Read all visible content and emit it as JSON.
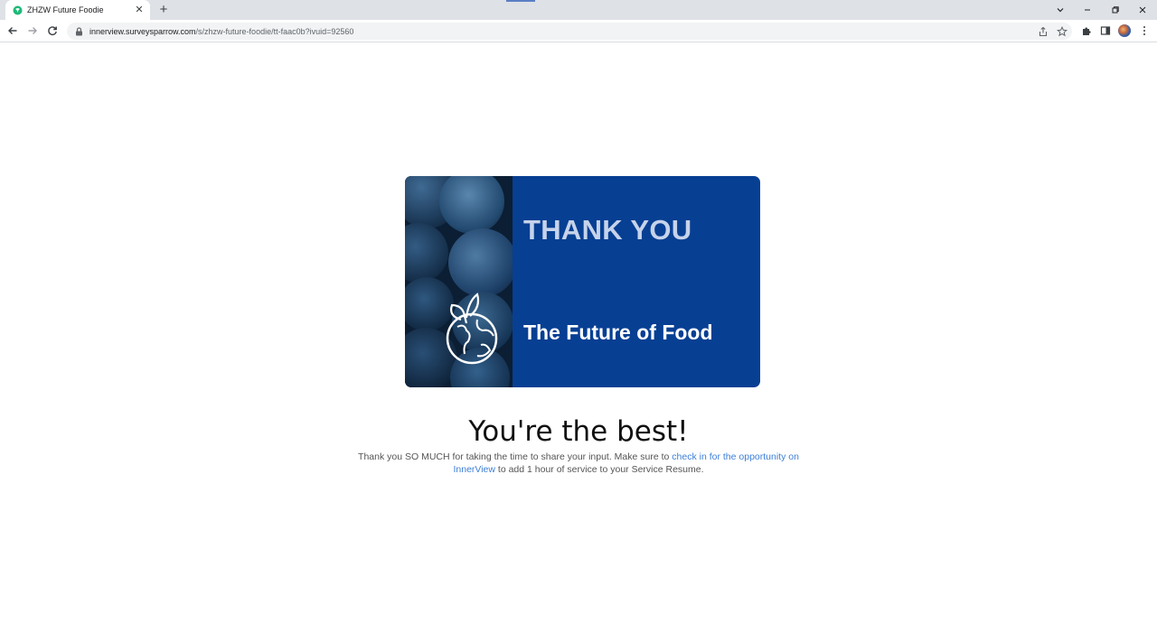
{
  "browser": {
    "tab_title": "ZHZW Future Foodie",
    "url_host": "innerview.surveysparrow.com",
    "url_path": "/s/zhzw-future-foodie/tt-faac0b?ivuid=92560"
  },
  "banner": {
    "heading": "THANK YOU",
    "subheading": "The Future of Food"
  },
  "content": {
    "headline": "You're the best!",
    "message_start": "Thank you SO MUCH for taking the time to share your input. Make sure to ",
    "link_text": "check in for the opportunity on InnerView",
    "message_end": " to add 1 hour of service to your Service Resume."
  },
  "colors": {
    "banner_blue": "#073f93",
    "link_blue": "#3d7fd6",
    "heading_light": "#c6d3ea"
  }
}
